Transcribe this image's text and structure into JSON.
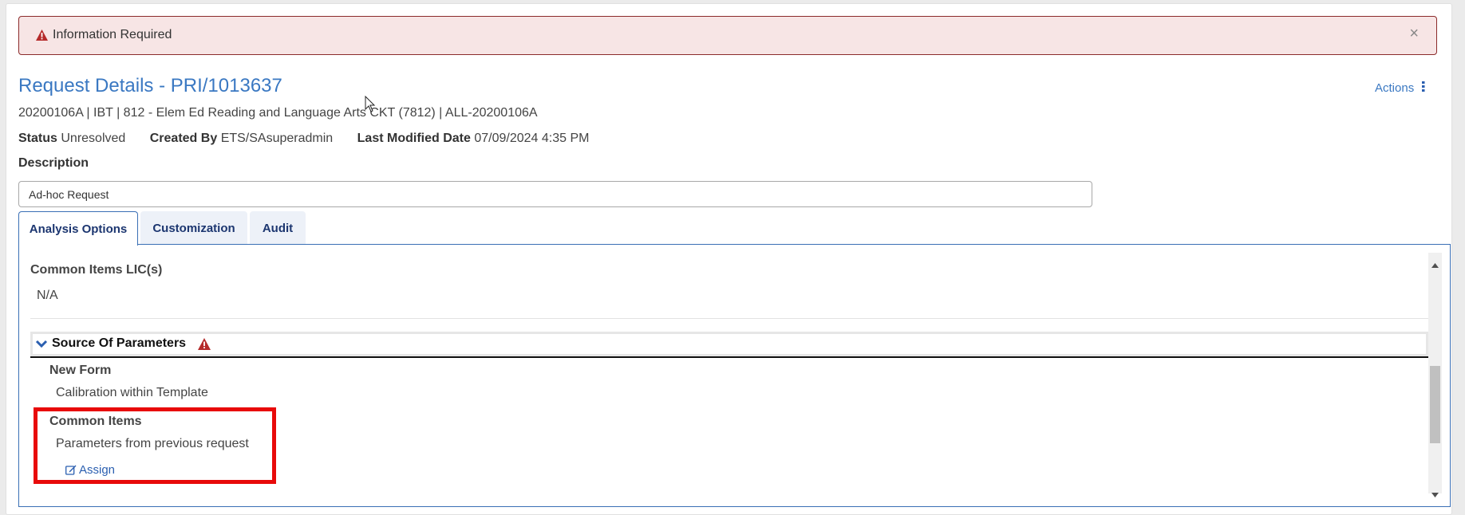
{
  "alert": {
    "icon": "warning-icon",
    "text": "Information Required",
    "close_label": "×"
  },
  "header": {
    "title": "Request Details - PRI/1013637",
    "actions_label": "Actions",
    "actions_icon": "kebab-menu-icon",
    "subtitle": "20200106A | IBT | 812 - Elem Ed Reading and Language Arts CKT (7812) | ALL-20200106A",
    "meta": [
      {
        "label": "Status",
        "value": "Unresolved"
      },
      {
        "label": "Created By",
        "value": "ETS/SAsuperadmin"
      },
      {
        "label": "Last Modified Date",
        "value": "07/09/2024 4:35 PM"
      }
    ]
  },
  "description": {
    "label": "Description",
    "value": "Ad-hoc Request"
  },
  "tabs": [
    {
      "label": "Analysis Options",
      "active": true
    },
    {
      "label": "Customization",
      "active": false
    },
    {
      "label": "Audit",
      "active": false
    }
  ],
  "panel": {
    "common_items_lic": {
      "label": "Common Items LIC(s)",
      "value": "N/A"
    },
    "source_section": {
      "title": "Source Of Parameters",
      "expanded": true,
      "warning_icon": "warning-icon",
      "new_form": {
        "label": "New Form",
        "value": "Calibration within Template"
      },
      "common_items": {
        "label": "Common Items",
        "value": "Parameters from previous request",
        "action_label": "Assign",
        "action_icon": "edit-icon"
      }
    }
  },
  "colors": {
    "link_blue": "#3a78c2",
    "tab_text": "#1c3670",
    "alert_bg": "#f7e5e5",
    "alert_border": "#8b2a2a",
    "warning_red": "#c0392b",
    "highlight_red": "#e80a0a"
  }
}
